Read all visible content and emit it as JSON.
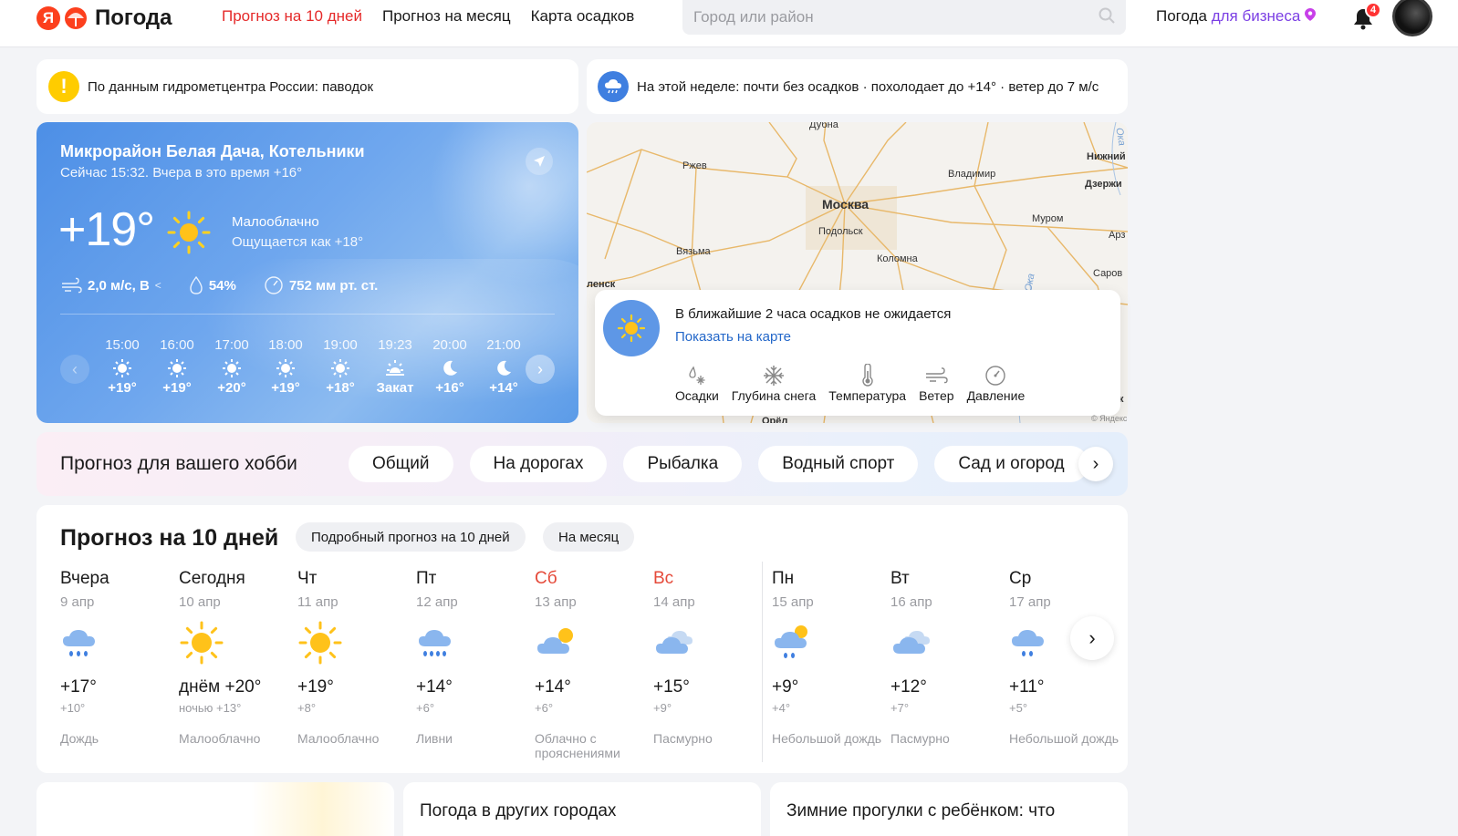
{
  "header": {
    "logo_letter": "Я",
    "logo_text": "Погода",
    "nav": [
      {
        "label": "Прогноз на 10 дней",
        "active": true
      },
      {
        "label": "Прогноз на месяц",
        "active": false
      },
      {
        "label": "Карта осадков",
        "active": false
      }
    ],
    "search_placeholder": "Город или район",
    "business_1": "Погода ",
    "business_2": "для бизнеса",
    "notifications": "4"
  },
  "alerts": {
    "warning": "По данным гидрометцентра России: паводок",
    "week": "На этой неделе: почти без осадков · похолодает до +14° · ветер до 7 м/с"
  },
  "current": {
    "location": "Микрорайон Белая Дача, Котельники",
    "time_line": "Сейчас 15:32. Вчера в это время +16°",
    "temp": "+19°",
    "condition": "Малооблачно",
    "feels_like": "Ощущается как +18°",
    "wind": "2,0 м/с, В",
    "humidity": "54%",
    "pressure": "752 мм рт. ст.",
    "hours": [
      {
        "time": "15:00",
        "icon": "sun-icon",
        "value": "+19°"
      },
      {
        "time": "16:00",
        "icon": "sun-icon",
        "value": "+19°"
      },
      {
        "time": "17:00",
        "icon": "sun-icon",
        "value": "+20°"
      },
      {
        "time": "18:00",
        "icon": "sun-icon",
        "value": "+19°"
      },
      {
        "time": "19:00",
        "icon": "sun-icon",
        "value": "+18°"
      },
      {
        "time": "19:23",
        "icon": "sunset-icon",
        "value": "Закат"
      },
      {
        "time": "20:00",
        "icon": "moon-icon",
        "value": "+16°"
      },
      {
        "time": "21:00",
        "icon": "moon-icon",
        "value": "+14°"
      }
    ]
  },
  "map": {
    "cities": [
      "Дубна",
      "Ржев",
      "Владимир",
      "Москва",
      "Подольск",
      "Муром",
      "Вязьма",
      "Коломна",
      "Нижний",
      "Дзержи",
      "Арз",
      "Саров",
      "ленск",
      "Орёл",
      "Ока",
      "Ока",
      "к"
    ],
    "nowcast_text": "В ближайшие 2 часа осадков не ожидается",
    "nowcast_link": "Показать на карте",
    "layers": [
      {
        "label": "Осадки",
        "icon": "precipitation-icon"
      },
      {
        "label": "Глубина снега",
        "icon": "snowflake-icon"
      },
      {
        "label": "Температура",
        "icon": "thermometer-icon"
      },
      {
        "label": "Ветер",
        "icon": "wind-icon"
      },
      {
        "label": "Давление",
        "icon": "pressure-icon"
      }
    ],
    "copyright": "© Яндекс"
  },
  "hobby": {
    "title": "Прогноз для вашего хобби",
    "chips": [
      "Общий",
      "На дорогах",
      "Рыбалка",
      "Водный спорт",
      "Сад и огород"
    ]
  },
  "forecast": {
    "title": "Прогноз на 10 дней",
    "pill_detail": "Подробный прогноз на 10 дней",
    "pill_month": "На месяц",
    "days": [
      {
        "name": "Вчера",
        "date": "9 апр",
        "day": "+17°",
        "night": "+10°",
        "cond": "Дождь",
        "icon": "rain-cloud-icon",
        "weekend": false
      },
      {
        "name": "Сегодня",
        "date": "10 апр",
        "day": "днём +20°",
        "night": "ночью +13°",
        "cond": "Малооблачно",
        "icon": "sun-icon",
        "weekend": false
      },
      {
        "name": "Чт",
        "date": "11 апр",
        "day": "+19°",
        "night": "+8°",
        "cond": "Малооблачно",
        "icon": "sun-icon",
        "weekend": false
      },
      {
        "name": "Пт",
        "date": "12 апр",
        "day": "+14°",
        "night": "+6°",
        "cond": "Ливни",
        "icon": "heavy-rain-icon",
        "weekend": false
      },
      {
        "name": "Сб",
        "date": "13 апр",
        "day": "+14°",
        "night": "+6°",
        "cond": "Облачно с прояснениями",
        "icon": "partly-cloudy-icon",
        "weekend": true
      },
      {
        "name": "Вс",
        "date": "14 апр",
        "day": "+15°",
        "night": "+9°",
        "cond": "Пасмурно",
        "icon": "overcast-icon",
        "weekend": true
      },
      {
        "name": "Пн",
        "date": "15 апр",
        "day": "+9°",
        "night": "+4°",
        "cond": "Небольшой дождь",
        "icon": "sun-rain-icon",
        "weekend": false
      },
      {
        "name": "Вт",
        "date": "16 апр",
        "day": "+12°",
        "night": "+7°",
        "cond": "Пасмурно",
        "icon": "overcast-icon",
        "weekend": false
      },
      {
        "name": "Ср",
        "date": "17 апр",
        "day": "+11°",
        "night": "+5°",
        "cond": "Небольшой дождь",
        "icon": "light-rain-icon",
        "weekend": false
      }
    ]
  },
  "bottom": {
    "other_cities": "Погода в других городах",
    "winter_walks": "Зимние прогулки с ребёнком: что"
  },
  "colors": {
    "accent_red": "#e52a2a",
    "link_blue": "#2367c9",
    "business_purple": "#7b3fe4",
    "weekend_red": "#e54a3a"
  }
}
